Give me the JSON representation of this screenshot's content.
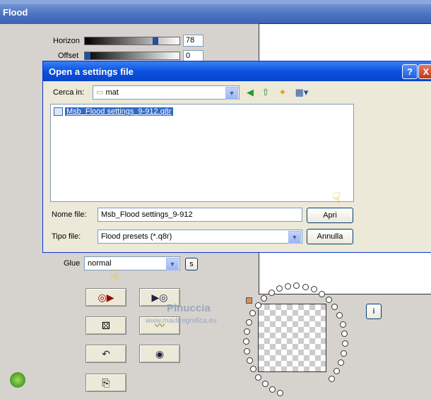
{
  "flood": {
    "title": "Flood",
    "horizon": {
      "label": "Horizon",
      "value": "78",
      "level": 0.85
    },
    "offset": {
      "label": "Offset",
      "value": "0",
      "level": 0.0
    },
    "glue": {
      "label": "Glue",
      "value": "normal"
    },
    "s_button": "s",
    "info_button": "i"
  },
  "dialog": {
    "title": "Open a settings file",
    "help": "?",
    "close": "X",
    "look_in_label": "Cerca in:",
    "look_in_value": "mat",
    "files": [
      "Msb_Flood settings_9-912.q8r"
    ],
    "filename_label": "Nome file:",
    "filename_value": "Msb_Flood settings_9-912",
    "filetype_label": "Tipo file:",
    "filetype_value": "Flood presets (*.q8r)",
    "open_button": "Apri",
    "cancel_button": "Annulla"
  },
  "watermark": {
    "name": "Pinuccia",
    "url": "www.maidiregrafica.eu"
  }
}
